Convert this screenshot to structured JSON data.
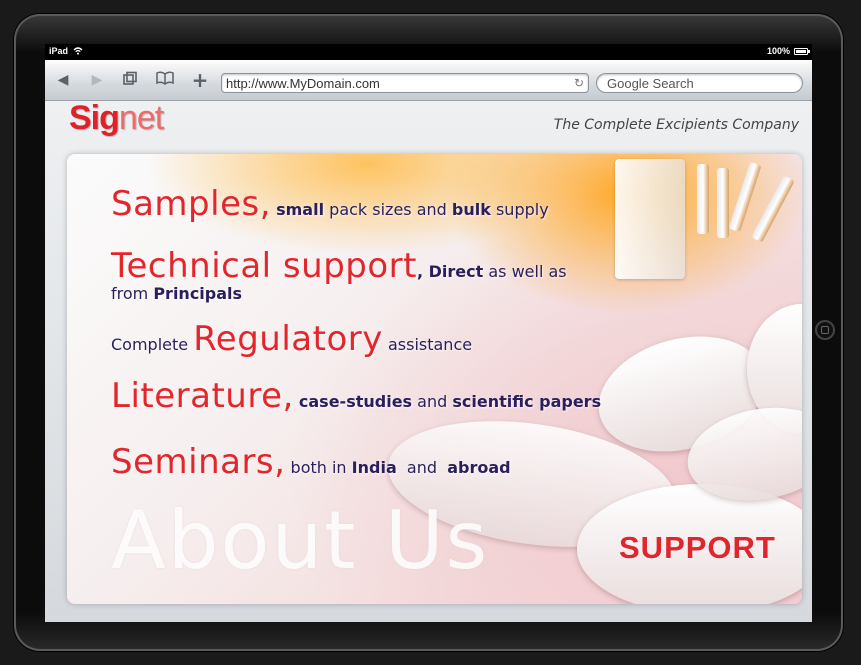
{
  "status": {
    "carrier": "iPad",
    "battery": "100%"
  },
  "browser": {
    "url": "http://www.MyDomain.com",
    "search_placeholder": "Google Search"
  },
  "site": {
    "logo_part1": "Sig",
    "logo_part2": "net",
    "tagline": "The Complete Excipients Company"
  },
  "banner": {
    "line1": {
      "big": "Samples,",
      "t1": "small",
      "t2": " pack sizes and ",
      "t3": "bulk",
      "t4": " supply"
    },
    "line2": {
      "big": "Technical support",
      "t1": ", ",
      "t2": "Direct",
      "t3": " as well as"
    },
    "line2b": {
      "t1": "from ",
      "t2": "Principals"
    },
    "line3": {
      "t1": "Complete ",
      "big": "Regulatory",
      "t2": " assistance"
    },
    "line4": {
      "big": "Literature,",
      "t1": "case-studies",
      "t2": " and ",
      "t3": "scientific papers"
    },
    "line5": {
      "big": "Seminars,",
      "t1": " both in ",
      "t2": "India",
      "t3": "  and  ",
      "t4": "abroad"
    },
    "about_us": "About Us",
    "support": "SUPPORT"
  }
}
